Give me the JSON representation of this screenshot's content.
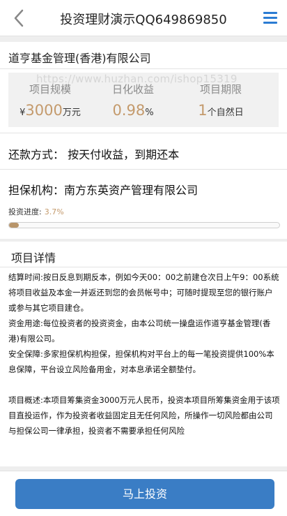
{
  "header": {
    "title": "投资理财演示QQ649869850",
    "back_icon": "chevron-left-icon",
    "menu_icon": "hamburger-menu-icon",
    "accent": "#2b7cd3"
  },
  "company": {
    "name": "道亨基金管理(香港)有限公司"
  },
  "watermark": "https://www.huzhan.com/ishop15319",
  "stats": {
    "scale": {
      "label": "项目规模",
      "currency": "¥",
      "value": "3000",
      "unit": "万元"
    },
    "yield": {
      "label": "日化收益",
      "value": "0.98",
      "unit": "%"
    },
    "term": {
      "label": "项目期限",
      "value": "1",
      "unit": "个自然日"
    }
  },
  "repayment": {
    "text": "还款方式： 按天付收益，到期还本"
  },
  "guarantor": {
    "text": "担保机构：南方东英资产管理有限公司"
  },
  "progress": {
    "label": "投资进度:",
    "percent_text": "3.7%",
    "value": 0.037
  },
  "details": {
    "heading": "项目详情",
    "p1": "结算时间:按日反息到期反本，例如今天00：00之前建仓次日上午9：00系统将项目收益及本金一并返还到您的会员帐号中；可随时提现至您的银行账户或参与其它项目建仓。",
    "p2": "资金用途:每位投资者的投资资金，由本公司统一操盘运作道亨基金管理(香港)有限公司。",
    "p3": "安全保障:多家担保机构担保，担保机构对平台上的每一笔投资提供100%本息保障，平台设立风险备用金，对本息承诺全额垫付。",
    "p4": "项目概述:本项目筹集资金3000万元人民币，投资本项目所筹集资金用于该项目直投运作，作为投资者收益固定且无任何风险，所操作一切风险都由公司与担保公司一律承担，投资者不需要承担任何风险"
  },
  "footer": {
    "invest_label": "马上投资",
    "button_color": "#3a7dc5"
  }
}
